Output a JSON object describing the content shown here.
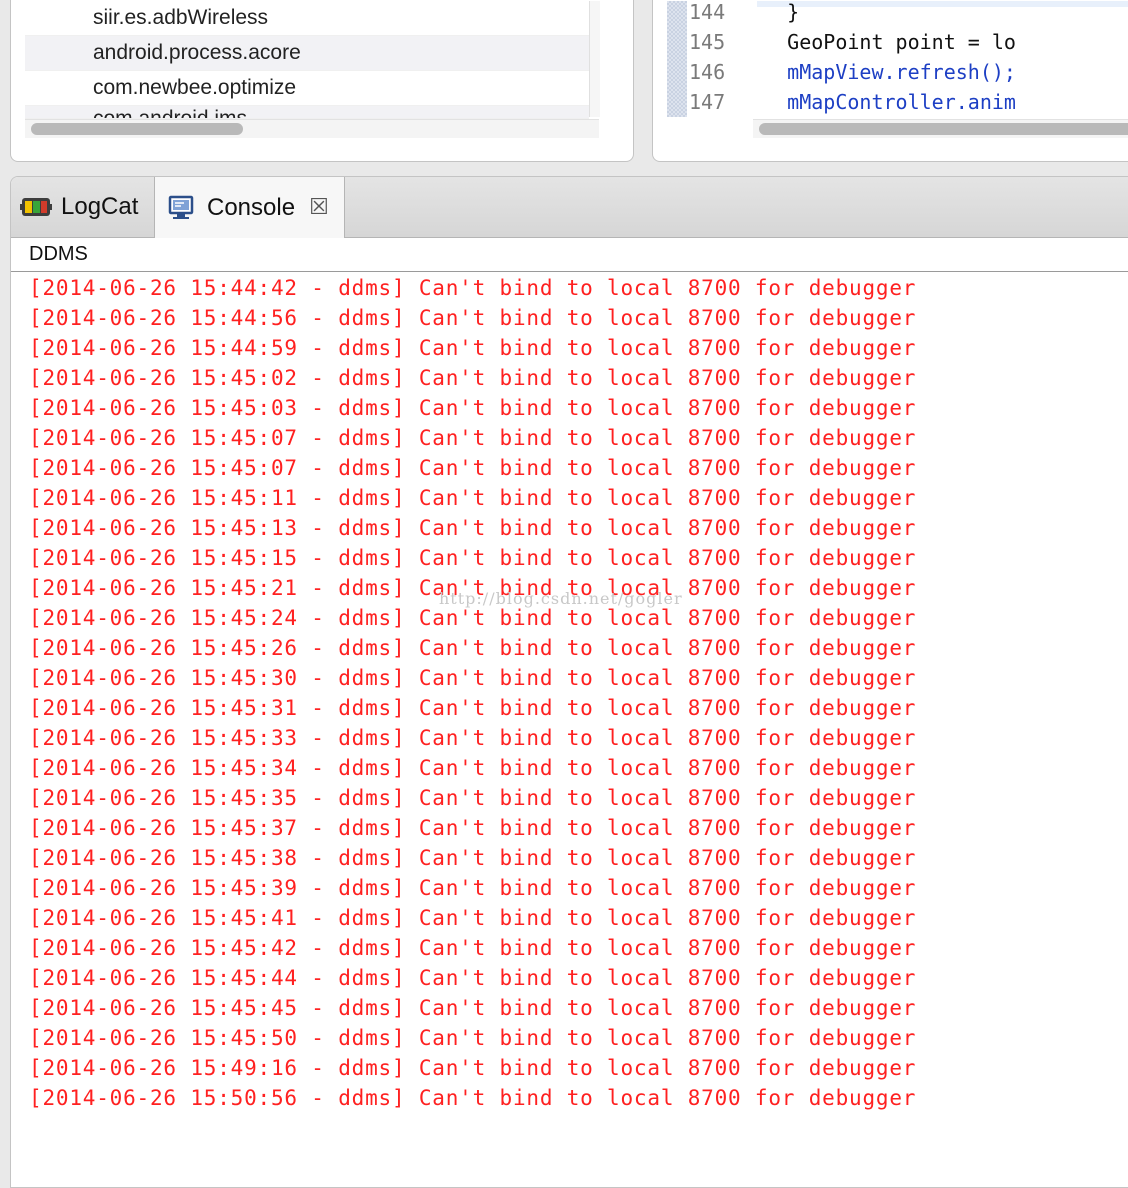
{
  "devices": {
    "rows": [
      {
        "name": "siir.es.adbWireless"
      },
      {
        "name": "android.process.acore"
      },
      {
        "name": "com.newbee.optimize"
      },
      {
        "name": "com.android.ims"
      }
    ]
  },
  "editor": {
    "lines": [
      {
        "number": "144",
        "code": "    }",
        "style": "plain"
      },
      {
        "number": "145",
        "code": "    GeoPoint point = lo",
        "style": "plain"
      },
      {
        "number": "146",
        "code": "    mMapView.refresh();",
        "style": "field"
      },
      {
        "number": "147",
        "code": "    mMapController.anim",
        "style": "field"
      }
    ]
  },
  "tabs": {
    "logcat_label": "LogCat",
    "console_label": "Console",
    "logcat_icon": "logcat-icon",
    "console_icon": "console-icon",
    "close_icon": "close-icon"
  },
  "console": {
    "title": "DDMS",
    "text_color": "#ff2020",
    "lines": [
      "[2014-06-26 15:44:42 - ddms] Can't bind to local 8700 for debugger",
      "[2014-06-26 15:44:56 - ddms] Can't bind to local 8700 for debugger",
      "[2014-06-26 15:44:59 - ddms] Can't bind to local 8700 for debugger",
      "[2014-06-26 15:45:02 - ddms] Can't bind to local 8700 for debugger",
      "[2014-06-26 15:45:03 - ddms] Can't bind to local 8700 for debugger",
      "[2014-06-26 15:45:07 - ddms] Can't bind to local 8700 for debugger",
      "[2014-06-26 15:45:07 - ddms] Can't bind to local 8700 for debugger",
      "[2014-06-26 15:45:11 - ddms] Can't bind to local 8700 for debugger",
      "[2014-06-26 15:45:13 - ddms] Can't bind to local 8700 for debugger",
      "[2014-06-26 15:45:15 - ddms] Can't bind to local 8700 for debugger",
      "[2014-06-26 15:45:21 - ddms] Can't bind to local 8700 for debugger",
      "[2014-06-26 15:45:24 - ddms] Can't bind to local 8700 for debugger",
      "[2014-06-26 15:45:26 - ddms] Can't bind to local 8700 for debugger",
      "[2014-06-26 15:45:30 - ddms] Can't bind to local 8700 for debugger",
      "[2014-06-26 15:45:31 - ddms] Can't bind to local 8700 for debugger",
      "[2014-06-26 15:45:33 - ddms] Can't bind to local 8700 for debugger",
      "[2014-06-26 15:45:34 - ddms] Can't bind to local 8700 for debugger",
      "[2014-06-26 15:45:35 - ddms] Can't bind to local 8700 for debugger",
      "[2014-06-26 15:45:37 - ddms] Can't bind to local 8700 for debugger",
      "[2014-06-26 15:45:38 - ddms] Can't bind to local 8700 for debugger",
      "[2014-06-26 15:45:39 - ddms] Can't bind to local 8700 for debugger",
      "[2014-06-26 15:45:41 - ddms] Can't bind to local 8700 for debugger",
      "[2014-06-26 15:45:42 - ddms] Can't bind to local 8700 for debugger",
      "[2014-06-26 15:45:44 - ddms] Can't bind to local 8700 for debugger",
      "[2014-06-26 15:45:45 - ddms] Can't bind to local 8700 for debugger",
      "[2014-06-26 15:45:50 - ddms] Can't bind to local 8700 for debugger",
      "[2014-06-26 15:49:16 - ddms] Can't bind to local 8700 for debugger",
      "[2014-06-26 15:50:56 - ddms] Can't bind to local 8700 for debugger"
    ]
  },
  "watermark": "http://blog.csdn.net/gogler"
}
